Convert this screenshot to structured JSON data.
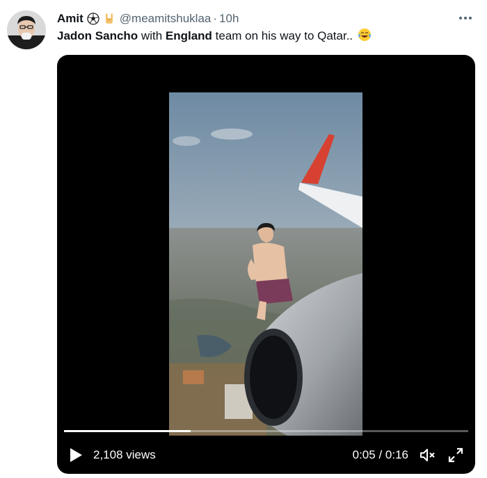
{
  "tweet": {
    "author_name": "Amit",
    "author_badges": [
      "soccer-ball-icon",
      "rock-hand-icon"
    ],
    "handle": "@meamitshuklaa",
    "separator": "·",
    "time": "10h",
    "text_parts": [
      {
        "text": "Jadon Sancho",
        "bold": true
      },
      {
        "text": " with ",
        "bold": false
      },
      {
        "text": "England",
        "bold": true
      },
      {
        "text": " team on his way to Qatar..",
        "bold": false
      }
    ],
    "emoji_icon": "tears-of-joy-emoji-icon"
  },
  "video": {
    "views": "2,108 views",
    "current_time": "0:05",
    "time_separator": "/",
    "duration": "0:16",
    "progress": 0.3125
  },
  "colors": {
    "text": "#0f1419",
    "secondary": "#536471",
    "video_bg": "#000000"
  }
}
